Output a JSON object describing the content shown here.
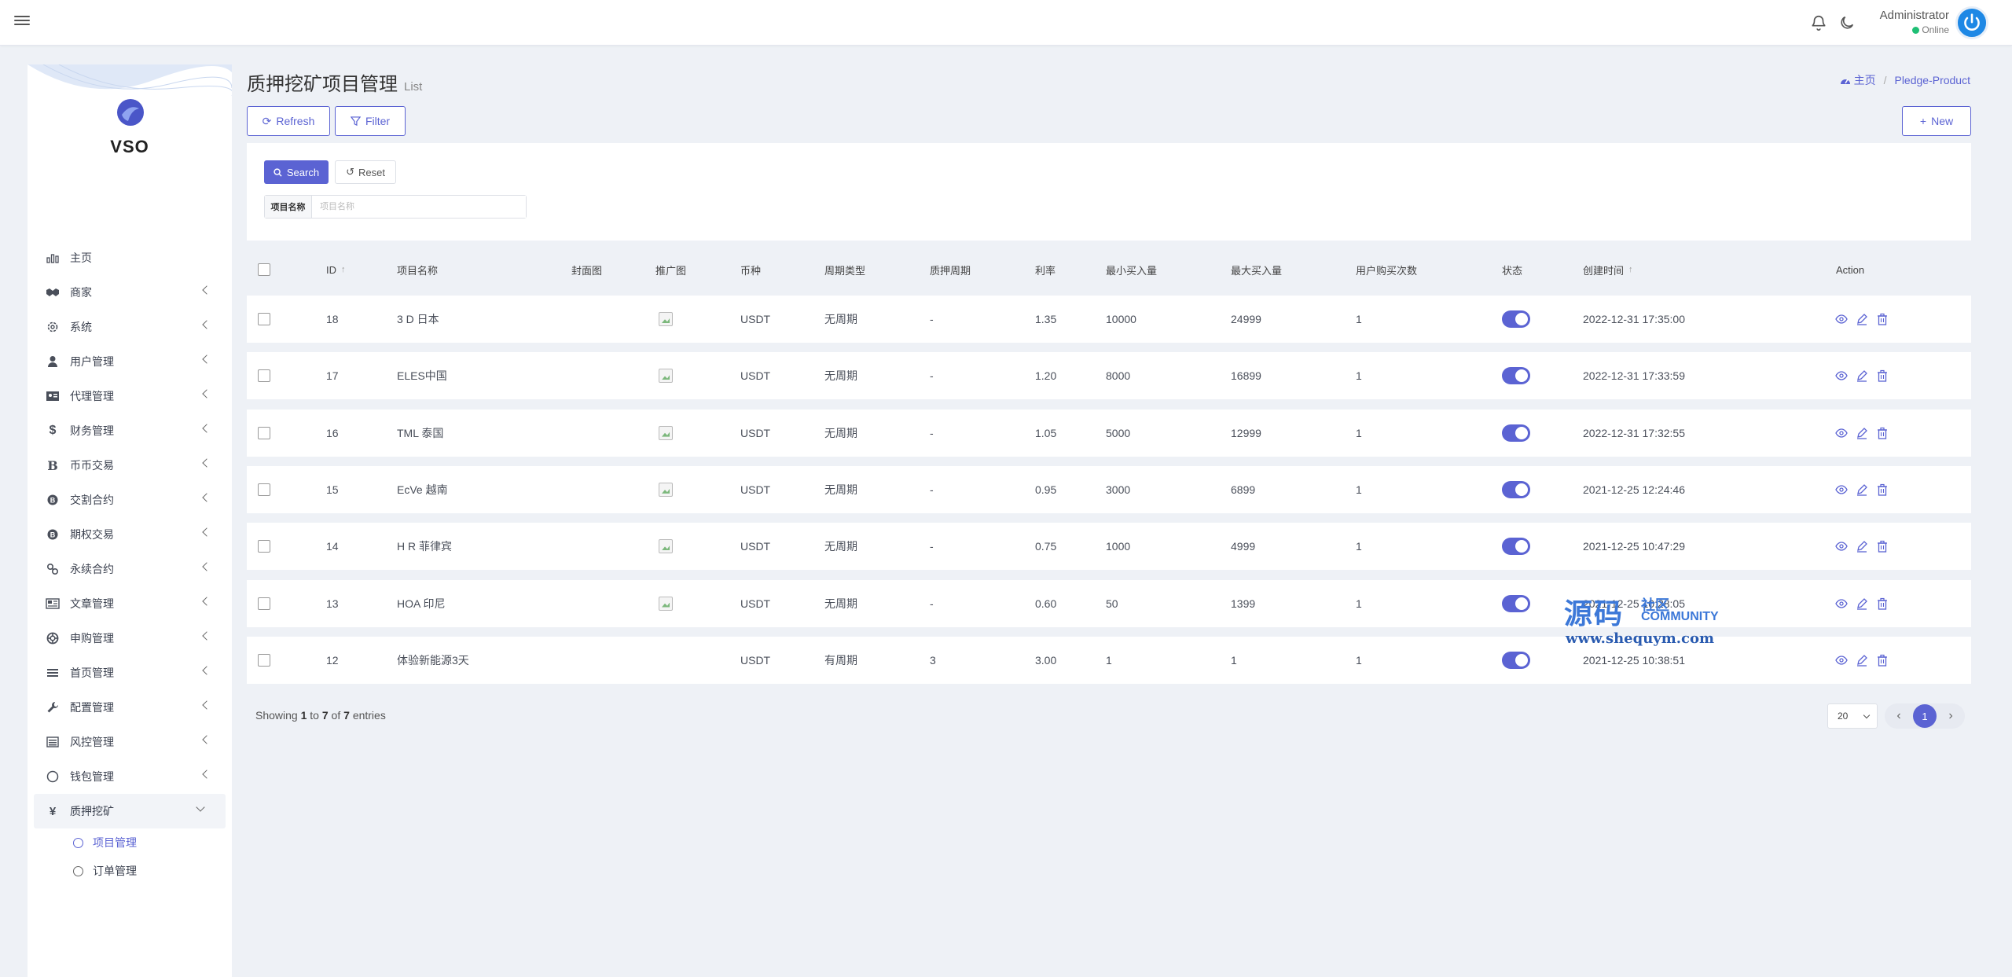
{
  "header": {
    "user_name": "Administrator",
    "user_status": "Online"
  },
  "brand": {
    "name": "VSO"
  },
  "sidebar": {
    "items": [
      {
        "label": "主页",
        "icon": "dashboard-icon",
        "has_chevron": false
      },
      {
        "label": "商家",
        "icon": "handshake-icon",
        "has_chevron": true
      },
      {
        "label": "系统",
        "icon": "gear-icon",
        "has_chevron": true
      },
      {
        "label": "用户管理",
        "icon": "user-icon",
        "has_chevron": true
      },
      {
        "label": "代理管理",
        "icon": "id-card-icon",
        "has_chevron": true
      },
      {
        "label": "财务管理",
        "icon": "dollar-icon",
        "has_chevron": true
      },
      {
        "label": "币币交易",
        "icon": "bitcoin-icon",
        "has_chevron": true
      },
      {
        "label": "交割合约",
        "icon": "bitcoin-circle-icon",
        "has_chevron": true
      },
      {
        "label": "期权交易",
        "icon": "bitcoin-circle-icon",
        "has_chevron": true
      },
      {
        "label": "永续合约",
        "icon": "link-icon",
        "has_chevron": true
      },
      {
        "label": "文章管理",
        "icon": "newspaper-icon",
        "has_chevron": true
      },
      {
        "label": "申购管理",
        "icon": "lifebuoy-icon",
        "has_chevron": true
      },
      {
        "label": "首页管理",
        "icon": "list-icon",
        "has_chevron": true
      },
      {
        "label": "配置管理",
        "icon": "wrench-icon",
        "has_chevron": true
      },
      {
        "label": "风控管理",
        "icon": "list-alt-icon",
        "has_chevron": true
      },
      {
        "label": "钱包管理",
        "icon": "circle-icon",
        "has_chevron": true
      },
      {
        "label": "质押挖矿",
        "icon": "yen-icon",
        "has_chevron": true,
        "expanded": true
      }
    ],
    "sub_items": [
      {
        "label": "项目管理",
        "active": true
      },
      {
        "label": "订单管理",
        "active": false
      }
    ]
  },
  "page": {
    "title": "质押挖矿项目管理",
    "subtitle": "List",
    "breadcrumb_home": "主页",
    "breadcrumb_current": "Pledge-Product"
  },
  "toolbar": {
    "refresh_label": "Refresh",
    "filter_label": "Filter",
    "new_label": "New"
  },
  "filter": {
    "search_label": "Search",
    "reset_label": "Reset",
    "field_label": "项目名称",
    "field_placeholder": "项目名称",
    "field_value": ""
  },
  "table": {
    "columns": [
      "ID",
      "项目名称",
      "封面图",
      "推广图",
      "币种",
      "周期类型",
      "质押周期",
      "利率",
      "最小买入量",
      "最大买入量",
      "用户购买次数",
      "状态",
      "创建时间",
      "Action"
    ],
    "rows": [
      {
        "id": "18",
        "name": "3 D 日本",
        "cover": false,
        "promo": true,
        "coin": "USDT",
        "cycle_type": "无周期",
        "cycle": "-",
        "rate": "1.35",
        "min": "10000",
        "max": "24999",
        "times": "1",
        "status": true,
        "created": "2022-12-31 17:35:00"
      },
      {
        "id": "17",
        "name": "ELES中国",
        "cover": false,
        "promo": true,
        "coin": "USDT",
        "cycle_type": "无周期",
        "cycle": "-",
        "rate": "1.20",
        "min": "8000",
        "max": "16899",
        "times": "1",
        "status": true,
        "created": "2022-12-31 17:33:59"
      },
      {
        "id": "16",
        "name": "TML 泰国",
        "cover": false,
        "promo": true,
        "coin": "USDT",
        "cycle_type": "无周期",
        "cycle": "-",
        "rate": "1.05",
        "min": "5000",
        "max": "12999",
        "times": "1",
        "status": true,
        "created": "2022-12-31 17:32:55"
      },
      {
        "id": "15",
        "name": "EcVe 越南",
        "cover": false,
        "promo": true,
        "coin": "USDT",
        "cycle_type": "无周期",
        "cycle": "-",
        "rate": "0.95",
        "min": "3000",
        "max": "6899",
        "times": "1",
        "status": true,
        "created": "2021-12-25 12:24:46"
      },
      {
        "id": "14",
        "name": "H R 菲律宾",
        "cover": false,
        "promo": true,
        "coin": "USDT",
        "cycle_type": "无周期",
        "cycle": "-",
        "rate": "0.75",
        "min": "1000",
        "max": "4999",
        "times": "1",
        "status": true,
        "created": "2021-12-25 10:47:29"
      },
      {
        "id": "13",
        "name": "HOA 印尼",
        "cover": false,
        "promo": true,
        "coin": "USDT",
        "cycle_type": "无周期",
        "cycle": "-",
        "rate": "0.60",
        "min": "50",
        "max": "1399",
        "times": "1",
        "status": true,
        "created": "2021-12-25 10:28:05"
      },
      {
        "id": "12",
        "name": "体验新能源3天",
        "cover": false,
        "promo": false,
        "coin": "USDT",
        "cycle_type": "有周期",
        "cycle": "3",
        "rate": "3.00",
        "min": "1",
        "max": "1",
        "times": "1",
        "status": true,
        "created": "2021-12-25 10:38:51"
      }
    ]
  },
  "footer": {
    "showing_prefix": "Showing",
    "from": "1",
    "to_word": "to",
    "to": "7",
    "of_word": "of",
    "total": "7",
    "entries_word": "entries",
    "page_size": "20",
    "current_page": "1"
  },
  "watermark": {
    "big": "源码",
    "small": "社区",
    "community": "COMMUNITY",
    "url": "www.shequym.com"
  },
  "colors": {
    "accent": "#5b63d3",
    "background": "#eef1f6"
  }
}
